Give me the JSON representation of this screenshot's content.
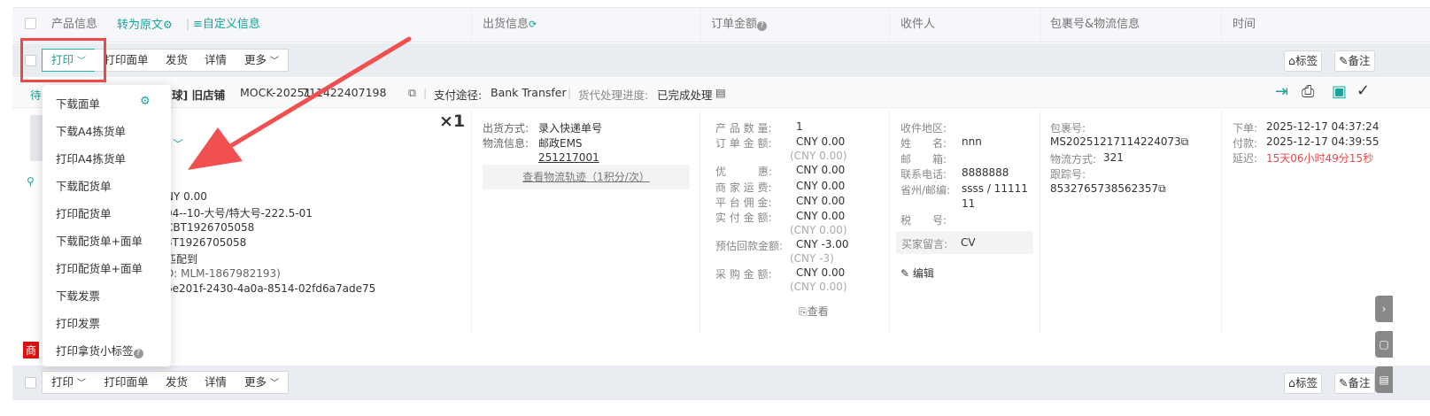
{
  "header": {
    "product_info": "产品信息",
    "convert_original": "转为原文",
    "custom_info": "自定义信息",
    "shipping_info": "出货信息",
    "order_amount": "订单金额",
    "recipient": "收件人",
    "package_logistics": "包裹号&物流信息",
    "time": "时间"
  },
  "toolbar": {
    "print": "打印",
    "print_label": "打印面单",
    "ship": "发货",
    "details": "详情",
    "more": "更多",
    "tag": "标签",
    "note": "备注"
  },
  "order_bar": {
    "status_prefix": "待",
    "store_suffix": "球] 旧店铺",
    "order_no": "MOCK-20251217114224 07198",
    "order_no_visible_left": "MOCK-20251",
    "order_no_visible_right": "711422407198",
    "payment_label": "支付途径:",
    "payment_value": "Bank Transfer",
    "agent_label": "货代处理进度:",
    "agent_value": "已完成处理"
  },
  "product": {
    "quantity": "×1",
    "line1": "NY 0.00",
    "line2": "04--10-大号/特大号-222.5-01",
    "line3": "CBT1926705058",
    "line4": "3T1926705058",
    "line5": "匹配到",
    "line6": "D: MLM-1867982193)",
    "line7": "6e201f-2430-4a0a-8514-02fd6a7ade75"
  },
  "shipping": {
    "method_label": "出货方式:",
    "method_value": "录入快递单号",
    "logistics_label": "物流信息:",
    "logistics_value": "邮政EMS",
    "tracking_link": "251217001",
    "track_button": "查看物流轨迹（1积分/次）"
  },
  "amount": {
    "qty_label": "产 品 数 量:",
    "qty_value": "1",
    "order_label": "订 单 金 额:",
    "order_value": "CNY 0.00",
    "order_sub": "(CNY 0.00)",
    "discount_label": "优　　　惠:",
    "discount_value": "CNY 0.00",
    "freight_label": "商 家 运 费:",
    "freight_value": "CNY 0.00",
    "commission_label": "平 台 佣 金:",
    "commission_value": "CNY 0.00",
    "paid_label": "实 付 金 额:",
    "paid_value": "CNY 0.00",
    "paid_sub": "(CNY 0.00)",
    "estimate_label": "预估回款金额:",
    "estimate_value": "CNY -3.00",
    "estimate_sub": "(CNY -3)",
    "purchase_label": "采 购 金 额:",
    "purchase_value": "CNY 0.00",
    "purchase_sub": "(CNY 0.00)",
    "view": "查看"
  },
  "recipient": {
    "region_label": "收件地区:",
    "name_label": "姓　　名:",
    "name_value": "nnn",
    "email_label": "邮　　箱:",
    "phone_label": "联系电话:",
    "phone_value": "8888888",
    "province_label": "省州/邮编:",
    "province_value": "ssss / 11111",
    "province_value2": "11",
    "tax_label": "税　　号:",
    "buyer_msg_label": "买家留言:",
    "buyer_msg_value": "CV",
    "edit": "编辑"
  },
  "package": {
    "pkg_label": "包裹号:",
    "pkg_value": "MS20251217114224073",
    "method_label": "物流方式:",
    "method_value": "321",
    "tracking_label": "跟踪号:",
    "tracking_value": "8532765738562357"
  },
  "time": {
    "order_label": "下单:",
    "order_value": "2025-12-17 04:37:24",
    "pay_label": "付款:",
    "pay_value": "2025-12-17 04:39:55",
    "delay_label": "延迟:",
    "delay_value": "15天06小时49分15秒"
  },
  "menu": {
    "items": [
      "下载面单",
      "下载A4拣货单",
      "打印A4拣货单",
      "下载配货单",
      "打印配货单",
      "下载配货单+面单",
      "打印配货单+面单",
      "下载发票",
      "打印发票",
      "打印拿货小标签"
    ]
  },
  "merchant_tag": "商",
  "colors": {
    "accent": "#1aa39a",
    "arrow": "#f05050",
    "delay": "#f04848"
  }
}
